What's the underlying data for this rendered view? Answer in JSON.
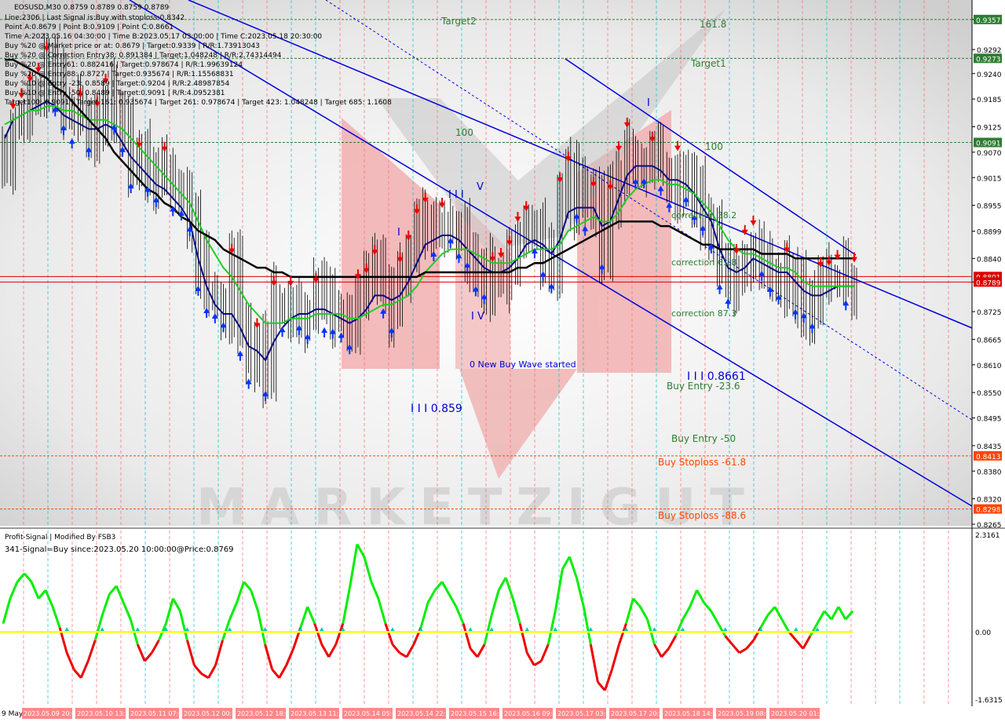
{
  "colors": {
    "bg": "#ffffff",
    "panel": "#e6e6e6",
    "candle": "#000000",
    "ma_green": "#22cc22",
    "ma_blue": "#0a0a80",
    "ma_black": "#000000",
    "channel": "#0000dd",
    "red_line": "#dd0000",
    "osc_pos": "#00ee00",
    "osc_neg": "#ee0000",
    "zero": "#ffff00",
    "target_green": "#2e7d32",
    "orange": "#ff4500",
    "arrow_up": "#0033ff",
    "arrow_dn": "#ee0000",
    "cyan": "#00c8c8"
  },
  "header": {
    "title": "EOSUSD,M30  0.8759 0.8789 0.8759 0.8789",
    "lines": [
      "Line:2306 | Last Signal is:Buy with stoploss:0.8342",
      "Point A:0.8679 | Point B:0.9109 | Point C:0.8661",
      "Time A:2023.05.16 04:30:00 | Time B:2023.05.17 03:00:00 | Time C:2023.05.18 20:30:00",
      "Buy %20 @ Market price or at: 0.8679 | Target:0.9339 | R/R:1.73913043",
      "Buy %20 @ Correction Entry38: 0.891384 | Target:1.048248 | R/R:2.74314494",
      "Buy %20 @ Entry61: 0.882416 | Target:0.978674 | R/R:1.99639124",
      "Buy %20 @ Entry88: 0.8727 | Target:0.935674 | R/R:1.15568831",
      "Buy %10 @ Entry -23: 0.8589 | Target:0.9204 | R/R:2.48987854",
      "Buy %10 @ Entry -50: 0.8489 | Target:0.9091 | R/R:4.0952381",
      "Target100: 0.9091 | Target 161: 0.935674 | Target 261: 0.978674 | Target 423: 1.048248 | Target 685: 1.1608"
    ]
  },
  "annotations": {
    "target2": "Target2",
    "fib1618": "161.8",
    "target1": "Target1",
    "left100": "100",
    "right100": "100",
    "wave_I_top": "I",
    "wave_I": "I",
    "wave_III": "I I I",
    "wave_V": "V",
    "wave_IV": "I V",
    "corr382": "correction 38.2",
    "corr618": "correction 61.8",
    "corr873": "correction 87.3",
    "new_wave": "0 New Buy Wave started",
    "low1": "I I I 0.859",
    "low2": "I I I 0.8661",
    "buy_entry_236": "Buy Entry -23.6",
    "buy_entry_50": "Buy Entry -50",
    "stop_618": "Buy Stoploss -61.8",
    "stop_886": "Buy Stoploss -88.6",
    "watermark": "MARKETZIGUT"
  },
  "oscillator": {
    "title": "Profit-Signal | Modified By FSB3",
    "signal": "341-Signal=Buy since:2023.05.20 10:00:00@Price:0.8769",
    "ticks": [
      "2.3161",
      "0.00",
      "-1.6315"
    ]
  },
  "x_axis": {
    "start": "9 May",
    "labels": [
      "2023.05.09 20:00",
      "2023.05.10 13:30",
      "2023.05.11 07:00",
      "2023.05.12 00:30",
      "2023.05.12 18:00",
      "2023.05.13 11:30",
      "2023.05.14 05:00",
      "2023.05.14 22:30",
      "2023.05.15 16:00",
      "2023.05.16 09:30",
      "2023.05.17 03:00",
      "2023.05.17 20:30",
      "2023.05.18 14:30",
      "2023.05.19 08:00",
      "2023.05.20 01:30"
    ]
  },
  "chart_data": {
    "type": "line",
    "symbol": "EOSUSD",
    "timeframe": "M30",
    "ylim": [
      0.8265,
      0.9389
    ],
    "y_ticks": [
      "0.9357",
      "0.9292",
      "0.9240",
      "0.9185",
      "0.9125",
      "0.9070",
      "0.9015",
      "0.8955",
      "0.8899",
      "0.8840",
      "0.8789",
      "0.8725",
      "0.8665",
      "0.8610",
      "0.8550",
      "0.8495",
      "0.8435",
      "0.8380",
      "0.8320",
      "0.8265"
    ],
    "levels": [
      {
        "name": "Target2",
        "value": 0.9357,
        "color": "#2e7d32",
        "label": "0.9357"
      },
      {
        "name": "Target1",
        "value": 0.9273,
        "color": "#2e7d32",
        "label": "0.9273"
      },
      {
        "name": "100",
        "value": 0.9091,
        "color": "#2e7d32",
        "label": "0.9091"
      },
      {
        "name": "Signal",
        "value": 0.8801,
        "color": "#dd0000",
        "label": "0.8801"
      },
      {
        "name": "Price",
        "value": 0.8789,
        "color": "#dd0000",
        "label": "0.8789"
      },
      {
        "name": "Stoploss 61.8",
        "value": 0.8413,
        "color": "#ff4500",
        "label": "0.8413"
      },
      {
        "name": "Stoploss 88.6",
        "value": 0.8298,
        "color": "#ff4500",
        "label": "0.8298"
      }
    ],
    "series": [
      {
        "name": "EOSUSD close",
        "values": [
          0.905,
          0.912,
          0.915,
          0.918,
          0.921,
          0.925,
          0.921,
          0.916,
          0.914,
          0.915,
          0.912,
          0.914,
          0.919,
          0.917,
          0.911,
          0.904,
          0.905,
          0.902,
          0.9,
          0.903,
          0.899,
          0.898,
          0.894,
          0.882,
          0.877,
          0.875,
          0.874,
          0.881,
          0.868,
          0.862,
          0.866,
          0.859,
          0.874,
          0.872,
          0.875,
          0.873,
          0.871,
          0.875,
          0.873,
          0.872,
          0.871,
          0.868,
          0.876,
          0.878,
          0.881,
          0.877,
          0.873,
          0.879,
          0.885,
          0.89,
          0.893,
          0.889,
          0.892,
          0.891,
          0.889,
          0.886,
          0.882,
          0.879,
          0.88,
          0.881,
          0.884,
          0.888,
          0.891,
          0.89,
          0.885,
          0.882,
          0.896,
          0.902,
          0.897,
          0.895,
          0.895,
          0.886,
          0.896,
          0.903,
          0.908,
          0.905,
          0.904,
          0.906,
          0.903,
          0.899,
          0.903,
          0.901,
          0.897,
          0.894,
          0.891,
          0.882,
          0.879,
          0.882,
          0.885,
          0.887,
          0.884,
          0.881,
          0.88,
          0.882,
          0.877,
          0.875,
          0.874,
          0.878,
          0.879,
          0.88,
          0.878,
          0.879
        ]
      },
      {
        "name": "MA fast",
        "values": [
          0.91,
          0.914,
          0.915,
          0.916,
          0.917,
          0.918,
          0.917,
          0.915,
          0.914,
          0.913,
          0.912,
          0.912,
          0.913,
          0.912,
          0.909,
          0.906,
          0.904,
          0.902,
          0.9,
          0.899,
          0.897,
          0.895,
          0.892,
          0.884,
          0.878,
          0.874,
          0.872,
          0.872,
          0.869,
          0.865,
          0.864,
          0.862,
          0.866,
          0.869,
          0.871,
          0.872,
          0.872,
          0.873,
          0.873,
          0.872,
          0.871,
          0.87,
          0.871,
          0.873,
          0.876,
          0.876,
          0.875,
          0.876,
          0.879,
          0.883,
          0.887,
          0.888,
          0.889,
          0.889,
          0.888,
          0.886,
          0.884,
          0.882,
          0.881,
          0.881,
          0.882,
          0.884,
          0.887,
          0.888,
          0.887,
          0.885,
          0.888,
          0.894,
          0.895,
          0.895,
          0.895,
          0.891,
          0.892,
          0.897,
          0.902,
          0.904,
          0.904,
          0.904,
          0.903,
          0.901,
          0.901,
          0.9,
          0.898,
          0.895,
          0.892,
          0.886,
          0.882,
          0.881,
          0.882,
          0.884,
          0.883,
          0.882,
          0.881,
          0.881,
          0.879,
          0.877,
          0.876,
          0.876,
          0.877,
          0.878,
          0.878,
          0.878
        ]
      },
      {
        "name": "MA medium",
        "values": [
          0.913,
          0.914,
          0.915,
          0.916,
          0.916,
          0.917,
          0.917,
          0.916,
          0.916,
          0.915,
          0.914,
          0.914,
          0.914,
          0.913,
          0.912,
          0.91,
          0.908,
          0.906,
          0.904,
          0.902,
          0.9,
          0.898,
          0.896,
          0.892,
          0.888,
          0.885,
          0.882,
          0.88,
          0.877,
          0.874,
          0.872,
          0.87,
          0.87,
          0.87,
          0.871,
          0.871,
          0.871,
          0.872,
          0.872,
          0.872,
          0.872,
          0.871,
          0.871,
          0.872,
          0.873,
          0.874,
          0.874,
          0.875,
          0.876,
          0.878,
          0.881,
          0.883,
          0.885,
          0.886,
          0.886,
          0.886,
          0.885,
          0.884,
          0.883,
          0.883,
          0.883,
          0.884,
          0.885,
          0.886,
          0.886,
          0.886,
          0.887,
          0.89,
          0.891,
          0.892,
          0.893,
          0.892,
          0.892,
          0.894,
          0.897,
          0.899,
          0.9,
          0.901,
          0.901,
          0.9,
          0.9,
          0.899,
          0.898,
          0.896,
          0.894,
          0.891,
          0.888,
          0.886,
          0.885,
          0.885,
          0.884,
          0.883,
          0.882,
          0.882,
          0.881,
          0.879,
          0.878,
          0.878,
          0.878,
          0.878,
          0.878,
          0.878
        ]
      },
      {
        "name": "MA slow",
        "values": [
          0.927,
          0.927,
          0.926,
          0.925,
          0.924,
          0.923,
          0.921,
          0.92,
          0.918,
          0.916,
          0.914,
          0.912,
          0.91,
          0.907,
          0.905,
          0.903,
          0.901,
          0.899,
          0.898,
          0.896,
          0.895,
          0.893,
          0.892,
          0.89,
          0.889,
          0.888,
          0.886,
          0.885,
          0.884,
          0.883,
          0.882,
          0.882,
          0.881,
          0.881,
          0.88,
          0.88,
          0.88,
          0.88,
          0.88,
          0.88,
          0.88,
          0.88,
          0.88,
          0.88,
          0.88,
          0.88,
          0.88,
          0.88,
          0.88,
          0.88,
          0.881,
          0.881,
          0.881,
          0.881,
          0.881,
          0.881,
          0.881,
          0.881,
          0.881,
          0.881,
          0.881,
          0.882,
          0.882,
          0.883,
          0.883,
          0.884,
          0.885,
          0.886,
          0.887,
          0.888,
          0.889,
          0.89,
          0.891,
          0.892,
          0.892,
          0.892,
          0.892,
          0.892,
          0.891,
          0.891,
          0.89,
          0.889,
          0.888,
          0.887,
          0.887,
          0.886,
          0.886,
          0.886,
          0.886,
          0.886,
          0.885,
          0.885,
          0.885,
          0.885,
          0.884,
          0.884,
          0.884,
          0.884,
          0.884,
          0.884,
          0.884,
          0.884
        ]
      }
    ],
    "oscillator": {
      "ylim": [
        -1.6315,
        2.3161
      ],
      "values": [
        0.2,
        0.8,
        1.2,
        1.4,
        1.2,
        0.8,
        1.0,
        0.6,
        0.1,
        -0.5,
        -0.9,
        -1.1,
        -0.7,
        -0.2,
        0.4,
        0.9,
        1.1,
        0.7,
        0.3,
        -0.3,
        -0.7,
        -0.5,
        -0.2,
        0.2,
        0.8,
        0.5,
        -0.2,
        -0.8,
        -1.0,
        -1.1,
        -0.8,
        -0.2,
        0.3,
        0.7,
        1.2,
        1.0,
        0.5,
        -0.3,
        -0.9,
        -1.1,
        -0.8,
        -0.4,
        0.1,
        0.6,
        0.2,
        -0.3,
        -0.6,
        -0.3,
        0.2,
        1.1,
        2.1,
        1.8,
        1.2,
        0.8,
        0.2,
        -0.3,
        -0.5,
        -0.6,
        -0.3,
        0.1,
        0.7,
        1.0,
        1.2,
        0.9,
        0.6,
        0.2,
        -0.4,
        -0.6,
        -0.3,
        0.4,
        1.0,
        1.3,
        0.8,
        0.2,
        -0.5,
        -0.8,
        -0.7,
        -0.3,
        0.5,
        1.5,
        1.8,
        1.3,
        0.6,
        -0.3,
        -1.2,
        -1.4,
        -0.9,
        -0.3,
        0.2,
        0.8,
        0.6,
        0.3,
        -0.3,
        -0.6,
        -0.4,
        -0.1,
        0.3,
        0.6,
        1.0,
        0.7,
        0.5,
        0.2,
        -0.1,
        -0.3,
        -0.5,
        -0.4,
        -0.2,
        0.1,
        0.4,
        0.6,
        0.3,
        0.0,
        -0.2,
        -0.4,
        -0.1,
        0.2,
        0.5,
        0.3,
        0.6,
        0.3,
        0.5
      ]
    }
  }
}
